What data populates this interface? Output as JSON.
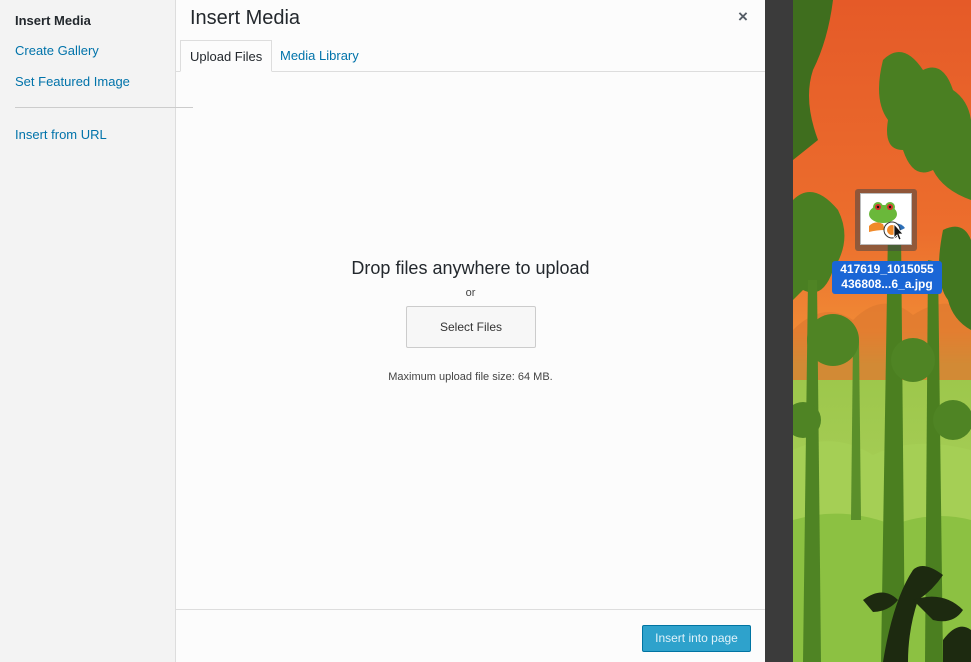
{
  "menu": {
    "items": [
      {
        "label": "Insert Media",
        "active": true
      },
      {
        "label": "Create Gallery",
        "active": false
      },
      {
        "label": "Set Featured Image",
        "active": false
      },
      {
        "label": "Insert from URL",
        "active": false
      }
    ]
  },
  "frame": {
    "title": "Insert Media",
    "close_glyph": "×",
    "close_icon": "close-icon"
  },
  "router": {
    "tabs": [
      {
        "label": "Upload Files",
        "active": true
      },
      {
        "label": "Media Library",
        "active": false
      }
    ]
  },
  "uploader": {
    "drop_text": "Drop files anywhere to upload",
    "or_text": "or",
    "select_button": "Select Files",
    "max_size_text": "Maximum upload file size: 64 MB."
  },
  "toolbar": {
    "insert_button": "Insert into page"
  },
  "drag": {
    "file_name_line1": "417619_1015055",
    "file_name_line2": "436808...6_a.jpg",
    "icon": "image-file-icon",
    "cursor_icon": "drag-copy-cursor-icon"
  },
  "colors": {
    "link": "#0073aa",
    "primary_button": "#2ea2cc",
    "selection": "#1a66d6",
    "sky_orange": "#e8632c",
    "foliage_green": "#7bb63a"
  }
}
